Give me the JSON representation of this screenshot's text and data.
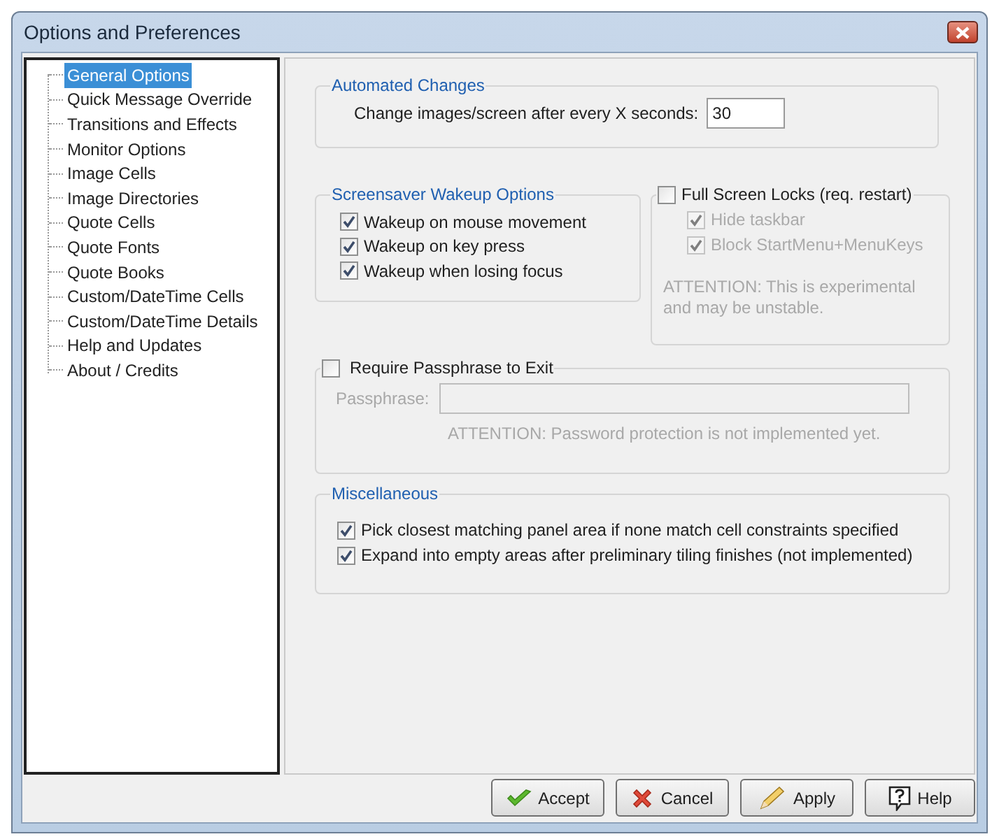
{
  "window": {
    "title": "Options and Preferences"
  },
  "tree": {
    "items": [
      {
        "label": "General Options",
        "selected": true
      },
      {
        "label": "Quick Message Override",
        "selected": false
      },
      {
        "label": "Transitions and Effects",
        "selected": false
      },
      {
        "label": "Monitor Options",
        "selected": false
      },
      {
        "label": "Image Cells",
        "selected": false
      },
      {
        "label": "Image Directories",
        "selected": false
      },
      {
        "label": "Quote Cells",
        "selected": false
      },
      {
        "label": "Quote Fonts",
        "selected": false
      },
      {
        "label": "Quote Books",
        "selected": false
      },
      {
        "label": "Custom/DateTime Cells",
        "selected": false
      },
      {
        "label": "Custom/DateTime Details",
        "selected": false
      },
      {
        "label": "Help and Updates",
        "selected": false
      },
      {
        "label": "About / Credits",
        "selected": false
      }
    ]
  },
  "automated_changes": {
    "title": "Automated Changes",
    "label": "Change images/screen after every X seconds:",
    "value": "30"
  },
  "wakeup": {
    "title": "Screensaver Wakeup Options",
    "options": [
      {
        "label": "Wakeup on mouse movement",
        "checked": true
      },
      {
        "label": "Wakeup on key press",
        "checked": true
      },
      {
        "label": "Wakeup when losing focus",
        "checked": true
      }
    ]
  },
  "full_screen_locks": {
    "label": "Full Screen Locks (req. restart)",
    "checked": false,
    "options": [
      {
        "label": "Hide taskbar",
        "checked": true,
        "disabled": true
      },
      {
        "label": "Block StartMenu+MenuKeys",
        "checked": true,
        "disabled": true
      }
    ],
    "note": "ATTENTION: This is experimental and may be unstable."
  },
  "passphrase": {
    "label": "Require Passphrase to Exit",
    "checked": false,
    "field_label": "Passphrase:",
    "disabled": true,
    "note": "ATTENTION: Password protection is not implemented yet."
  },
  "miscellaneous": {
    "title": "Miscellaneous",
    "options": [
      {
        "label": "Pick closest matching panel area if none match cell constraints specified",
        "checked": true
      },
      {
        "label": "Expand into empty areas after preliminary tiling finishes (not implemented)",
        "checked": true
      }
    ]
  },
  "buttons": [
    {
      "label": "Accept",
      "kind": "accept"
    },
    {
      "label": "Cancel",
      "kind": "cancel"
    },
    {
      "label": "Apply",
      "kind": "apply"
    },
    {
      "label": "Help",
      "kind": "help"
    }
  ]
}
